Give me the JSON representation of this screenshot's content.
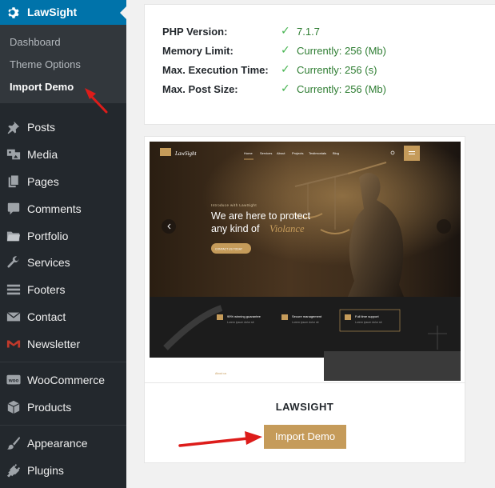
{
  "sidebar": {
    "plugin_title": "LawSight",
    "submenu": [
      "Dashboard",
      "Theme Options",
      "Import Demo"
    ],
    "items": [
      {
        "label": "Posts",
        "icon": "pin-icon"
      },
      {
        "label": "Media",
        "icon": "media-icon"
      },
      {
        "label": "Pages",
        "icon": "pages-icon"
      },
      {
        "label": "Comments",
        "icon": "comments-icon"
      },
      {
        "label": "Portfolio",
        "icon": "folder-icon"
      },
      {
        "label": "Services",
        "icon": "wrench-icon"
      },
      {
        "label": "Footers",
        "icon": "footers-icon"
      },
      {
        "label": "Contact",
        "icon": "envelope-icon"
      },
      {
        "label": "Newsletter",
        "icon": "newsletter-icon"
      },
      {
        "label": "WooCommerce",
        "icon": "woo-icon"
      },
      {
        "label": "Products",
        "icon": "box-icon"
      },
      {
        "label": "Appearance",
        "icon": "brush-icon"
      },
      {
        "label": "Plugins",
        "icon": "plug-icon"
      }
    ]
  },
  "system_info": [
    {
      "label": "PHP Version:",
      "value": "7.1.7"
    },
    {
      "label": "Memory Limit:",
      "value": "Currently: 256 (Mb)"
    },
    {
      "label": "Max. Execution Time:",
      "value": "Currently: 256 (s)"
    },
    {
      "label": "Max. Post Size:",
      "value": "Currently: 256 (Mb)"
    }
  ],
  "demo": {
    "name": "LAWSIGHT",
    "button": "Import Demo",
    "preview": {
      "logo": "LawSight",
      "nav": [
        "Home",
        "Services",
        "About",
        "Projects",
        "Testimonials",
        "Blog"
      ],
      "kicker": "Introduce with LawSight",
      "headline1": "We are here to protect",
      "headline2": "any kind of",
      "headline_accent": "Violance",
      "cta": "CONTACT US TODAY",
      "features": [
        {
          "title": "99% winning guarantee",
          "sub": "Lorem ipsum dolor sit"
        },
        {
          "title": "Secure management",
          "sub": "Lorem ipsum dolor sit"
        },
        {
          "title": "Full time support",
          "sub": "Lorem ipsum dolor sit"
        }
      ],
      "about": "About us"
    }
  },
  "colors": {
    "sidebar_bg": "#23282d",
    "active_blue": "#0073aa",
    "check_green": "#46b450",
    "gold": "#c59b5a",
    "arrow_red": "#dd1c1a"
  }
}
